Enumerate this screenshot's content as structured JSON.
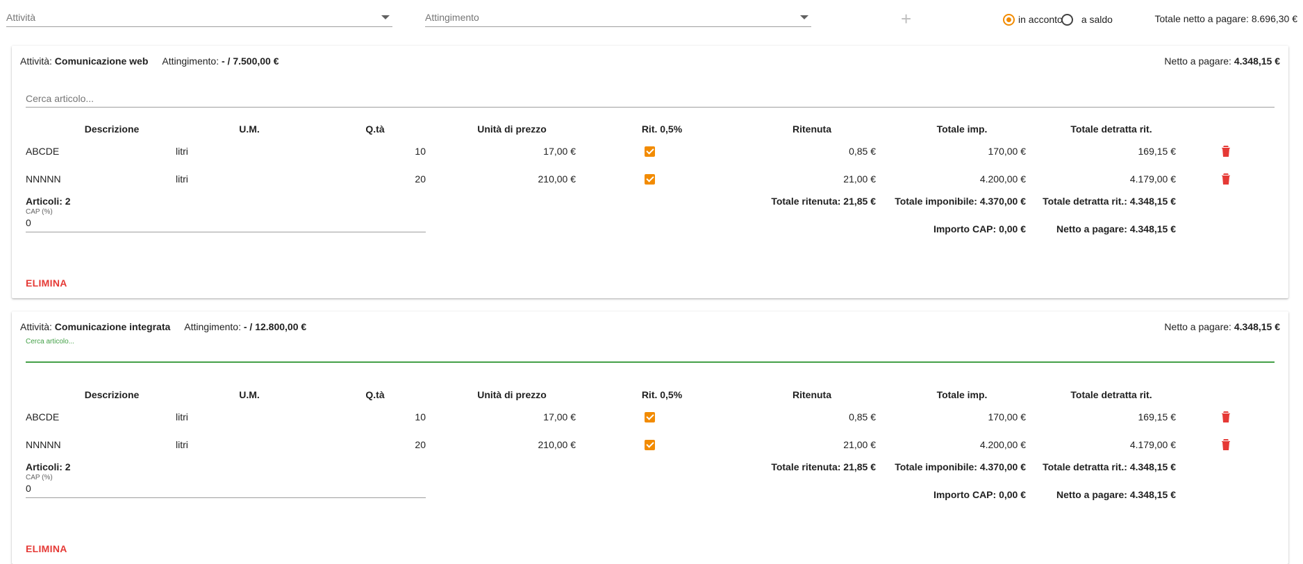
{
  "topbar": {
    "activity_placeholder": "Attività",
    "attingimento_placeholder": "Attingimento",
    "add_symbol": "+",
    "radio_acconto": "in acconto",
    "radio_saldo": "a saldo",
    "total_label": "Totale netto a pagare:",
    "total_value": "8.696,30 €"
  },
  "columns": {
    "descrizione": "Descrizione",
    "um": "U.M.",
    "qta": "Q.tà",
    "unit_price": "Unità di prezzo",
    "rit": "Rit. 0,5%",
    "ritenuta": "Ritenuta",
    "totale_imp": "Totale imp.",
    "totale_detratta": "Totale detratta rit."
  },
  "cards": [
    {
      "activity_label": "Attività:",
      "activity_name": "Comunicazione web",
      "attingimento_label": "Attingimento:",
      "attingimento_value": "- / 7.500,00 €",
      "net_label": "Netto a pagare:",
      "net_value": "4.348,15 €",
      "search_placeholder": "Cerca articolo...",
      "rows": [
        {
          "desc": "ABCDE",
          "um": "litri",
          "qty": "10",
          "price": "17,00 €",
          "ritenuta": "0,85 €",
          "totale_imp": "170,00 €",
          "totale_detratta": "169,15 €"
        },
        {
          "desc": "NNNNN",
          "um": "litri",
          "qty": "20",
          "price": "210,00 €",
          "ritenuta": "21,00 €",
          "totale_imp": "4.200,00 €",
          "totale_detratta": "4.179,00 €"
        }
      ],
      "articoli": "Articoli: 2",
      "cap_label": "CAP (%)",
      "cap_value": "0",
      "totale_ritenuta": "Totale ritenuta: 21,85 €",
      "totale_imponibile": "Totale imponibile: 4.370,00 €",
      "totale_detratta_rit": "Totale detratta rit.: 4.348,15 €",
      "importo_cap": "Importo CAP: 0,00 €",
      "netto_pagare": "Netto a pagare: 4.348,15 €",
      "delete_label": "ELIMINA"
    },
    {
      "activity_label": "Attività:",
      "activity_name": "Comunicazione integrata",
      "attingimento_label": "Attingimento:",
      "attingimento_value": "- / 12.800,00 €",
      "net_label": "Netto a pagare:",
      "net_value": "4.348,15 €",
      "search_placeholder": "Cerca articolo...",
      "rows": [
        {
          "desc": "ABCDE",
          "um": "litri",
          "qty": "10",
          "price": "17,00 €",
          "ritenuta": "0,85 €",
          "totale_imp": "170,00 €",
          "totale_detratta": "169,15 €"
        },
        {
          "desc": "NNNNN",
          "um": "litri",
          "qty": "20",
          "price": "210,00 €",
          "ritenuta": "21,00 €",
          "totale_imp": "4.200,00 €",
          "totale_detratta": "4.179,00 €"
        }
      ],
      "articoli": "Articoli: 2",
      "cap_label": "CAP (%)",
      "cap_value": "0",
      "totale_ritenuta": "Totale ritenuta: 21,85 €",
      "totale_imponibile": "Totale imponibile: 4.370,00 €",
      "totale_detratta_rit": "Totale detratta rit.: 4.348,15 €",
      "importo_cap": "Importo CAP: 0,00 €",
      "netto_pagare": "Netto a pagare: 4.348,15 €",
      "delete_label": "ELIMINA"
    }
  ],
  "colors": {
    "accent": "#f28b00",
    "danger": "#e53935",
    "focus": "#43a047"
  },
  "icons": {
    "row_action": "trash-icon",
    "checkbox": "checkbox-checked-icon",
    "dropdown": "chevron-down-icon"
  }
}
